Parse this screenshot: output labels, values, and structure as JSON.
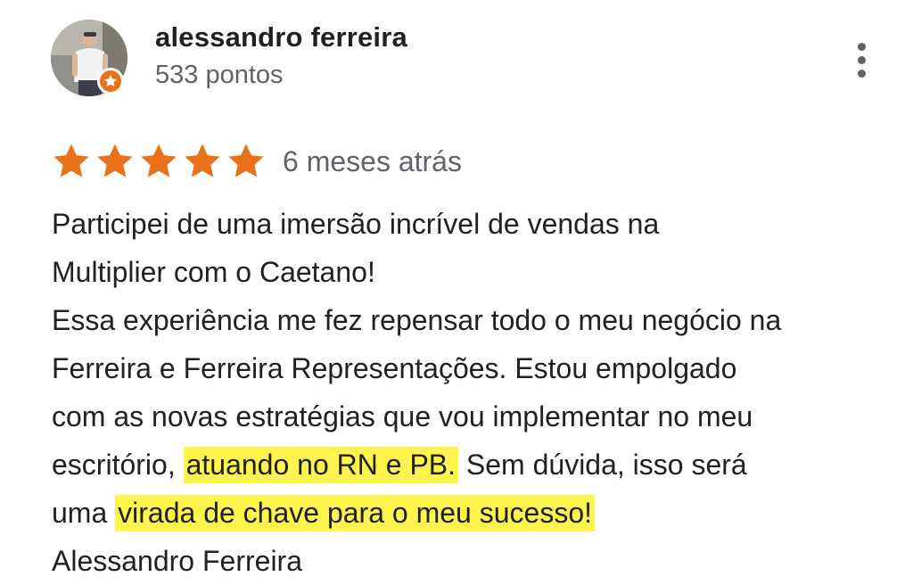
{
  "review": {
    "author": {
      "name": "alessandro ferreira",
      "points": "533 pontos",
      "avatar_icon": "user-photo",
      "badge_icon": "local-guide-star-icon"
    },
    "menu_icon": "more-vert-icon",
    "rating": {
      "stars": 5,
      "max": 5,
      "star_color": "#e8711a"
    },
    "time_ago": "6 meses atrás",
    "text": {
      "line1": "Participei de uma imersão incrível de vendas na",
      "line2": "Multiplier com o Caetano!",
      "line3": "Essa experiência me fez repensar todo o meu negócio na",
      "line4": "Ferreira e Ferreira Representações. Estou empolgado",
      "line5": "com as novas estratégias que vou implementar no meu",
      "line6_a": "escritório, ",
      "line6_b": "atuando no RN e PB.",
      "line6_c": " Sem dúvida, isso será",
      "line7_a": "uma ",
      "line7_b": "virada de chave para o meu sucesso!",
      "signature": "Alessandro Ferreira"
    },
    "highlight_color": "#fff34d"
  }
}
